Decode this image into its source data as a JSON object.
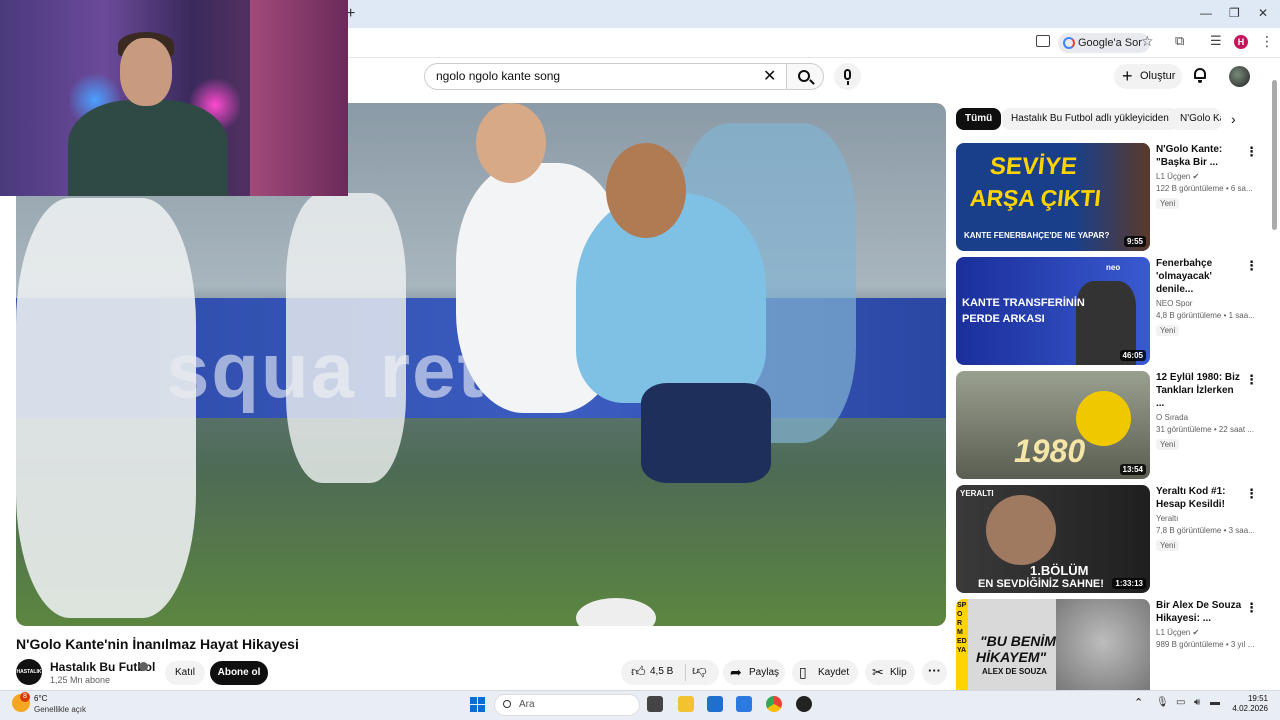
{
  "browser": {
    "new_tab_label": "+",
    "google_sor_label": "Google'a Sor",
    "profile_initial": "H"
  },
  "header": {
    "search_query": "ngolo ngolo kante song",
    "create_label": "Oluştur"
  },
  "player": {
    "board_text": "squa        ret"
  },
  "video": {
    "title": "N'Golo Kante'nin İnanılmaz Hayat Hikayesi",
    "channel_name": "Hastalık Bu Futbol",
    "channel_avatar_text": "HASTALIK",
    "subscribers": "1,25 Mn abone",
    "join_label": "Katıl",
    "subscribe_label": "Abone ol",
    "likes": "4,5 B",
    "share_label": "Paylaş",
    "save_label": "Kaydet",
    "clip_label": "Klip"
  },
  "chips": [
    {
      "label": "Tümü",
      "active": true
    },
    {
      "label": "Hastalık Bu Futbol adlı yükleyiciden",
      "active": false
    },
    {
      "label": "N'Golo Kante",
      "active": false
    }
  ],
  "recommendations": [
    {
      "title": "N'Golo Kante: \"Başka Bir ...",
      "channel": "L1 Üçgen",
      "verified": true,
      "meta": "122 B görüntüleme • 6 sa...",
      "badge": "Yeni",
      "duration": "9:55",
      "thumb_text_1": "SEVİYE",
      "thumb_text_2": "ARŞA ÇIKTI",
      "thumb_text_3": "KANTE FENERBAHÇE'DE NE YAPAR?",
      "thumb_bg": "#1a3f8a",
      "thumb_text_color": "#ffd400"
    },
    {
      "title": "Fenerbahçe 'olmayacak' denile...",
      "channel": "NEO Spor",
      "verified": false,
      "meta": "4,8 B görüntüleme • 1 saa...",
      "badge": "Yeni",
      "duration": "46:05",
      "thumb_text_1": "KANTE TRANSFERİNİN",
      "thumb_text_2": "PERDE ARKASI",
      "thumb_text_3": "neo",
      "thumb_bg": "#1a2f9a",
      "thumb_text_color": "#ffffff"
    },
    {
      "title": "12 Eylül 1980: Biz Tankları İzlerken ...",
      "channel": "O Sırada",
      "verified": false,
      "meta": "31 görüntüleme • 22 saat ...",
      "badge": "Yeni",
      "duration": "13:54",
      "thumb_text_1": "1980",
      "thumb_text_2": "",
      "thumb_text_3": "",
      "thumb_bg": "#6b6f63",
      "thumb_text_color": "#f5e6a8"
    },
    {
      "title": "Yeraltı Kod #1: Hesap Kesildi!",
      "channel": "Yeraltı",
      "verified": false,
      "meta": "7,8 B görüntüleme • 3 saa...",
      "badge": "Yeni",
      "duration": "1:33:13",
      "thumb_text_1": "YERALTI",
      "thumb_text_2": "1.BÖLÜM",
      "thumb_text_3": "EN SEVDİĞİNİZ SAHNE!",
      "thumb_bg": "#2a2a2a",
      "thumb_text_color": "#ffffff"
    },
    {
      "title": "Bir Alex De Souza Hikayesi: ...",
      "channel": "L1 Üçgen",
      "verified": true,
      "meta": "989 B görüntüleme • 3 yıl ...",
      "badge": "",
      "duration": "",
      "thumb_text_1": "\"BU BENİM",
      "thumb_text_2": "HİKAYEM\"",
      "thumb_text_3": "ALEX DE SOUZA",
      "thumb_text_side": "SPOR MEDYA",
      "thumb_bg": "#d9d9d9",
      "thumb_text_color": "#111111"
    }
  ],
  "taskbar": {
    "weather_badge": "8",
    "temperature": "6°C",
    "condition": "Genellikle açık",
    "search_placeholder": "Ara",
    "time": "19:51",
    "date": "4.02.2026"
  }
}
